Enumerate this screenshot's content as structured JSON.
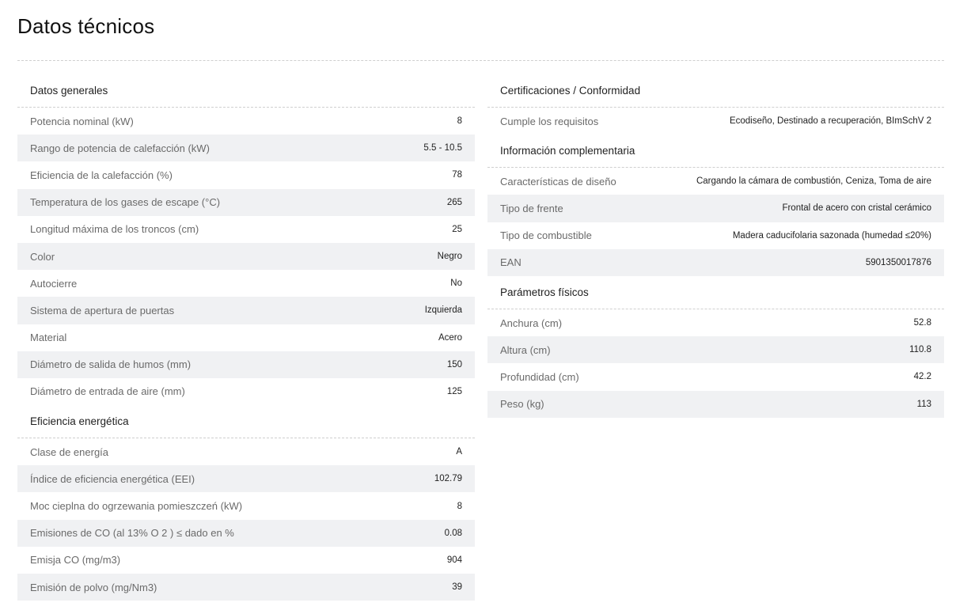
{
  "title": "Datos técnicos",
  "left_sections": [
    {
      "heading": "Datos generales",
      "rows": [
        {
          "label": "Potencia nominal (kW)",
          "value": "8"
        },
        {
          "label": "Rango de potencia de calefacción (kW)",
          "value": "5.5 - 10.5"
        },
        {
          "label": "Eficiencia de la calefacción (%)",
          "value": "78"
        },
        {
          "label": "Temperatura de los gases de escape (°C)",
          "value": "265"
        },
        {
          "label": "Longitud máxima de los troncos (cm)",
          "value": "25"
        },
        {
          "label": "Color",
          "value": "Negro"
        },
        {
          "label": "Autocierre",
          "value": "No"
        },
        {
          "label": "Sistema de apertura de puertas",
          "value": "Izquierda"
        },
        {
          "label": "Material",
          "value": "Acero"
        },
        {
          "label": "Diámetro de salida de humos (mm)",
          "value": "150"
        },
        {
          "label": "Diámetro de entrada de aire (mm)",
          "value": "125"
        }
      ]
    },
    {
      "heading": "Eficiencia energética",
      "rows": [
        {
          "label": "Clase de energía",
          "value": "A"
        },
        {
          "label": "Índice de eficiencia energética (EEI)",
          "value": "102.79"
        },
        {
          "label": "Moc cieplna do ogrzewania pomieszczeń (kW)",
          "value": "8"
        },
        {
          "label": "Emisiones de CO (al 13% O 2 ) ≤ dado en %",
          "value": "0.08"
        },
        {
          "label": "Emisja CO (mg/m3)",
          "value": "904"
        },
        {
          "label": "Emisión de polvo (mg/Nm3)",
          "value": "39"
        }
      ]
    }
  ],
  "right_sections": [
    {
      "heading": "Certificaciones / Conformidad",
      "rows": [
        {
          "label": "Cumple los requisitos",
          "value": "Ecodiseño, Destinado a recuperación, BImSchV 2"
        }
      ]
    },
    {
      "heading": "Información complementaria",
      "rows": [
        {
          "label": "Características de diseño",
          "value": "Cargando la cámara de combustión, Ceniza, Toma de aire"
        },
        {
          "label": "Tipo de frente",
          "value": "Frontal de acero con cristal cerámico"
        },
        {
          "label": "Tipo de combustible",
          "value": "Madera caducifolaria sazonada (humedad ≤20%)"
        },
        {
          "label": "EAN",
          "value": "5901350017876"
        }
      ]
    },
    {
      "heading": "Parámetros físicos",
      "rows": [
        {
          "label": "Anchura (cm)",
          "value": "52.8"
        },
        {
          "label": "Altura (cm)",
          "value": "110.8"
        },
        {
          "label": "Profundidad (cm)",
          "value": "42.2"
        },
        {
          "label": "Peso (kg)",
          "value": "113"
        }
      ]
    }
  ]
}
